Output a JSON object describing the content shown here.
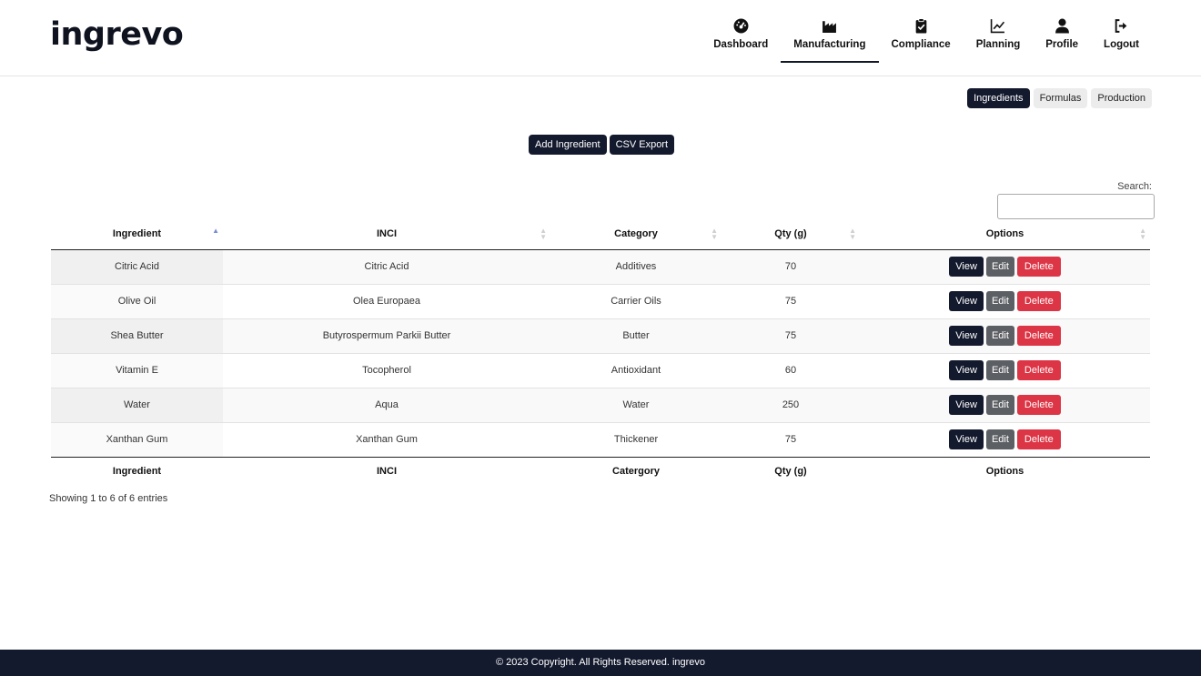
{
  "brand": {
    "logo_text": "ingrevo"
  },
  "nav": {
    "items": [
      {
        "label": "Dashboard",
        "icon": "dashboard-gauge-icon"
      },
      {
        "label": "Manufacturing",
        "icon": "factory-icon",
        "active": true
      },
      {
        "label": "Compliance",
        "icon": "clipboard-check-icon"
      },
      {
        "label": "Planning",
        "icon": "line-chart-icon"
      },
      {
        "label": "Profile",
        "icon": "user-icon"
      },
      {
        "label": "Logout",
        "icon": "logout-icon"
      }
    ]
  },
  "subtabs": {
    "ingredients": "Ingredients",
    "formulas": "Formulas",
    "production": "Production"
  },
  "actions": {
    "add_label": "Add Ingredient",
    "export_label": "CSV Export"
  },
  "search": {
    "label": "Search:",
    "value": ""
  },
  "table": {
    "headers": [
      "Ingredient",
      "INCI",
      "Category",
      "Qty (g)",
      "Options"
    ],
    "footers": [
      "Ingredient",
      "INCI",
      "Catergory",
      "Qty (g)",
      "Options"
    ],
    "rows": [
      {
        "ingredient": "Citric Acid",
        "inci": "Citric Acid",
        "category": "Additives",
        "qty": "70"
      },
      {
        "ingredient": "Olive Oil",
        "inci": "Olea Europaea",
        "category": "Carrier Oils",
        "qty": "75"
      },
      {
        "ingredient": "Shea Butter",
        "inci": "Butyrospermum Parkii Butter",
        "category": "Butter",
        "qty": "75"
      },
      {
        "ingredient": "Vitamin E",
        "inci": "Tocopherol",
        "category": "Antioxidant",
        "qty": "60"
      },
      {
        "ingredient": "Water",
        "inci": "Aqua",
        "category": "Water",
        "qty": "250"
      },
      {
        "ingredient": "Xanthan Gum",
        "inci": "Xanthan Gum",
        "category": "Thickener",
        "qty": "75"
      }
    ],
    "option_labels": {
      "view": "View",
      "edit": "Edit",
      "delete": "Delete"
    },
    "info": "Showing 1 to 6 of 6 entries"
  },
  "footer": {
    "text": "© 2023 Copyright. All Rights Reserved. ingrevo"
  },
  "colors": {
    "primary": "#141a2e",
    "danger": "#dc3545",
    "secondary": "#5c5f63",
    "sort_active": "#7a8ad1"
  }
}
